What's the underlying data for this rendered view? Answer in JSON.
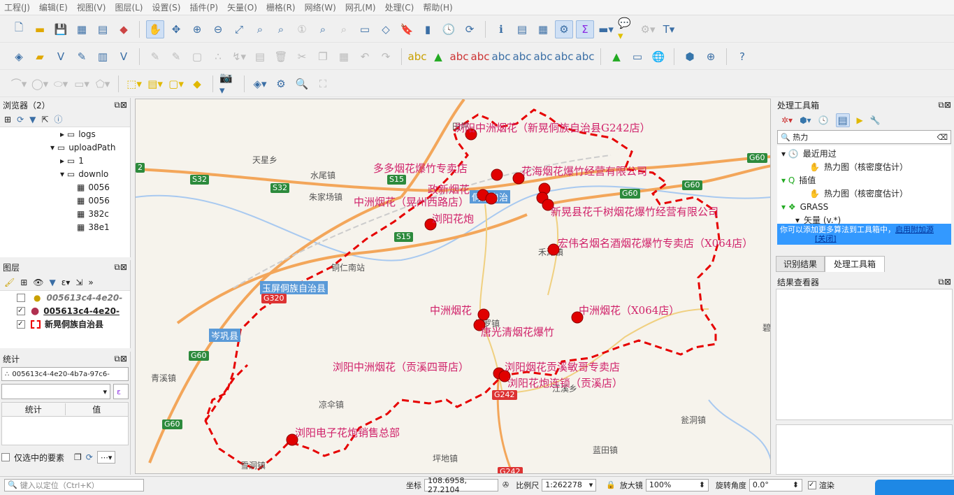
{
  "menu": [
    "工程(J)",
    "编辑(E)",
    "视图(V)",
    "图层(L)",
    "设置(S)",
    "插件(P)",
    "矢量(O)",
    "栅格(R)",
    "网络(W)",
    "网孔(M)",
    "处理(C)",
    "帮助(H)"
  ],
  "browser": {
    "title": "浏览器（2）",
    "items": [
      "logs",
      "uploadPath",
      "1",
      "downlo",
      "0056",
      "0056",
      "382c",
      "38e1"
    ]
  },
  "layers": {
    "title": "图层",
    "items": [
      {
        "name": "005613c4-4e20-",
        "checked": false
      },
      {
        "name": "005613c4-4e20-",
        "checked": true
      },
      {
        "name": "新晃侗族自治县",
        "checked": true
      }
    ]
  },
  "stats": {
    "title": "统计",
    "layer": "005613c4-4e20-4b7a-97c6-",
    "col1": "统计",
    "col2": "值",
    "selected_only": "仅选中的要素"
  },
  "toolbox": {
    "title": "处理工具箱",
    "search": "热力",
    "recent": "最近用过",
    "recent_item": "热力图（核密度估计）",
    "interp": "插值",
    "interp_item": "热力图（核密度估计）",
    "grass": "GRASS",
    "vector": "矢量 (v.*)",
    "notice": "你可以添加更多算法到工具箱中，",
    "notice_link": "启用附加源",
    "notice_close": "[关闭]"
  },
  "tabs": [
    "识别结果",
    "处理工具箱"
  ],
  "results": {
    "title": "结果查看器"
  },
  "status": {
    "locate_placeholder": "键入以定位（Ctrl+K）",
    "coord_label": "坐标",
    "coord": "108.6958, 27.2104",
    "scale_label": "比例尺",
    "scale": "1:262278",
    "magnifier_label": "放大镜",
    "magnifier": "100%",
    "rotation_label": "旋转角度",
    "rotation": "0.0°",
    "render": "渲染"
  },
  "map": {
    "labels": [
      "浏阳中洲烟花（新晃侗族自治县G242店）",
      "多多烟花爆竹专卖店",
      "花海烟花爆竹经营有限公司",
      "政新烟花",
      "中洲烟花（晃州西路店）",
      "浏阳花炮",
      "新晃县花千树烟花爆竹经营有限公司",
      "宏伟名烟名酒烟花爆竹专卖店（X064店）",
      "中洲烟花",
      "中洲烟花（X064店）",
      "唐光清烟花爆竹",
      "浏阳中洲烟花（贡溪四哥店）",
      "浏阳烟花贡溪敏哥专卖店",
      "浏阳花炮连锁（贡溪店）",
      "浏阳电子花炮销售总部"
    ],
    "places": [
      "天星乡",
      "水尾镇",
      "朱家场镇",
      "铜仁南站",
      "青溪镇",
      "凉伞镇",
      "雪洞镇",
      "坪地镇",
      "蓝田镇",
      "瓮洞镇",
      "江溪乡",
      "禾滩镇",
      "扶罗镇",
      "田坪",
      "碧"
    ],
    "counties": [
      "玉屏侗族自治县",
      "岑巩县",
      "侗族自治"
    ],
    "shields": [
      "S32",
      "S32",
      "S15",
      "S15",
      "G60",
      "G60",
      "G60",
      "G60",
      "G320",
      "G60",
      "G242",
      "G242",
      "2"
    ]
  }
}
